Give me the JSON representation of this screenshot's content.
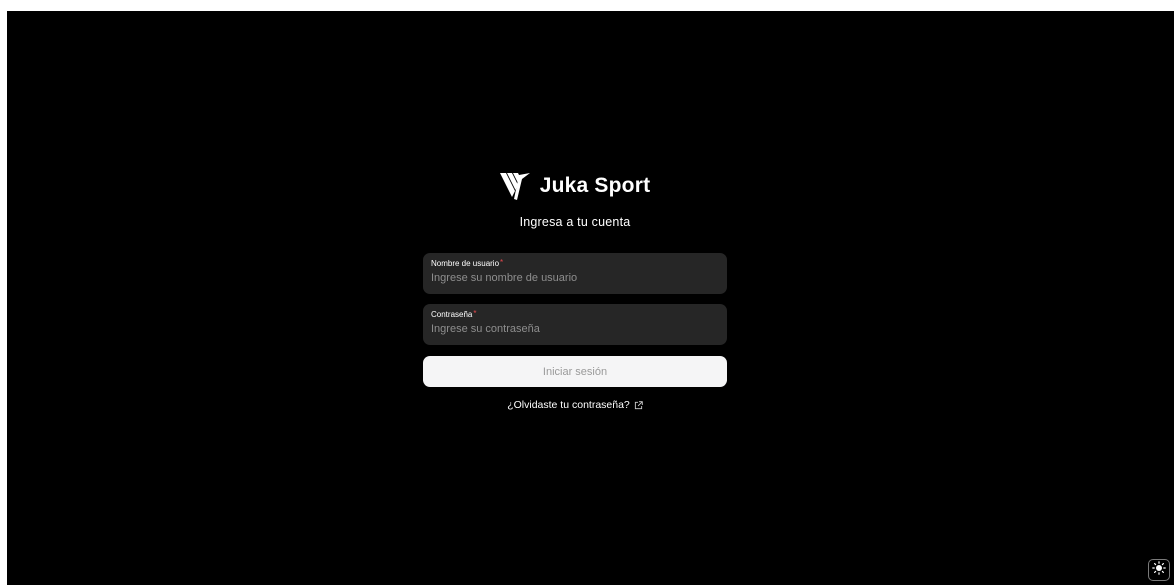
{
  "brand": {
    "name": "Juka Sport",
    "logo_icon": "juka-sport-logo"
  },
  "login": {
    "subtitle": "Ingresa a tu cuenta",
    "username": {
      "label": "Nombre de usuario",
      "required_mark": "*",
      "placeholder": "Ingrese su nombre de usuario",
      "value": ""
    },
    "password": {
      "label": "Contraseña",
      "required_mark": "*",
      "placeholder": "Ingrese su contraseña",
      "value": ""
    },
    "submit_label": "Iniciar sesión",
    "forgot_label": "¿Olvidaste tu contraseña?",
    "forgot_icon": "external-link-icon"
  },
  "theme_toggle": {
    "icon": "sun-icon"
  },
  "colors": {
    "background": "#000000",
    "field_background": "#262626",
    "button_background": "#f5f5f6",
    "required": "#e5484d"
  }
}
